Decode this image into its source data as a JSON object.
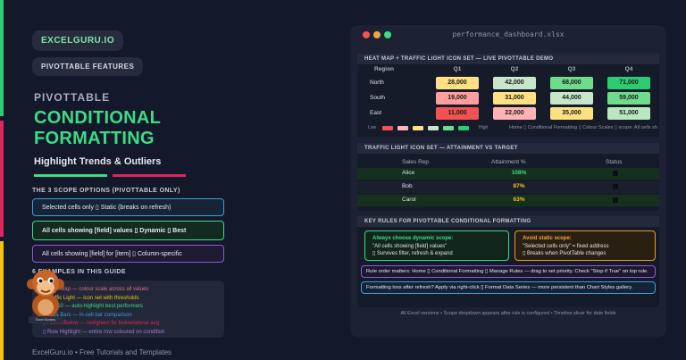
{
  "left": {
    "brand": "EXCELGURU.IO",
    "badge": "PIVOTTABLE FEATURES",
    "kicker": "PIVOTTABLE",
    "headline_1": "CONDITIONAL",
    "headline_2": "FORMATTING",
    "subhead": "Highlight Trends & Outliers",
    "scope_title": "THE 3 SCOPE OPTIONS (PIVOTTABLE ONLY)",
    "scope_options": [
      "Selected cells only ▯ Static (breaks on refresh)",
      "All cells showing [field] values ▯ Dynamic ▯ Best",
      "All cells showing [field] for [item] ▯ Column-specific"
    ],
    "examples_title": "6 EXAMPLES IN THIS GUIDE",
    "examples": [
      "▯ Heat Map — colour scale across all values",
      "▯ Traffic Light — icon set with thresholds",
      "▯ Top 10 — auto-highlight best performers",
      "▯ Data Bars — in-cell bar comparison",
      "▯ Above/Below — red/green for below/above avg",
      "▯ Row Highlight — entire row coloured on condition"
    ],
    "footer": "ExcelGuru.io • Free Tutorials and Templates",
    "mascot_label": "Excel Monkey"
  },
  "window": {
    "title": "performance_dashboard.xlsx",
    "heatmap": {
      "header": "HEAT MAP + TRAFFIC LIGHT ICON SET — LIVE PIVOTTABLE DEMO",
      "row_header": "Region",
      "columns": [
        "Q1",
        "Q2",
        "Q3",
        "Q4"
      ],
      "rows": [
        {
          "label": "North",
          "values": [
            "28,000",
            "42,000",
            "68,000",
            "71,000"
          ],
          "colors": [
            "#ffe082",
            "#c8e6c9",
            "#6fdc8c",
            "#2ecc71"
          ]
        },
        {
          "label": "South",
          "values": [
            "19,000",
            "31,000",
            "44,000",
            "59,000"
          ],
          "colors": [
            "#ff9e9e",
            "#ffe082",
            "#c8e6c9",
            "#6fdc8c"
          ]
        },
        {
          "label": "East",
          "values": [
            "11,000",
            "22,000",
            "35,000",
            "51,000"
          ],
          "colors": [
            "#f25252",
            "#ffb3b3",
            "#ffe082",
            "#b9e8c0"
          ]
        }
      ],
      "legend_low": "Low",
      "legend_high": "High",
      "legend_colors": [
        "#f25252",
        "#ffb3b3",
        "#ffe082",
        "#c8e6c9",
        "#6fdc8c",
        "#2ecc71"
      ],
      "legend_note": "Home ▯ Conditional Formatting ▯ Colour Scales ▯ scope: All cells showing Sales values"
    },
    "traffic": {
      "header": "TRAFFIC LIGHT ICON SET — ATTAINMENT VS TARGET",
      "columns": [
        "Sales Rep",
        "Attainment %",
        "Status"
      ],
      "rows": [
        {
          "name": "Alice",
          "pct": "108%",
          "color": "#3ddc84"
        },
        {
          "name": "Bob",
          "pct": "87%",
          "color": "#f1c40f"
        },
        {
          "name": "Carol",
          "pct": "63%",
          "color": "#f1c40f"
        }
      ]
    },
    "rules": {
      "header": "KEY RULES FOR PIVOTTABLE CONDITIONAL FORMATTING",
      "dynamic_title": "Always choose dynamic scope:",
      "dynamic_line1": "\"All cells showing [field] values\"",
      "dynamic_line2": "▯ Survives filter, refresh & expand",
      "static_title": "Avoid static scope:",
      "static_line1": "\"Selected cells only\" = fixed address",
      "static_line2": "▯ Breaks when PivotTable changes",
      "rule_order": "Rule order matters: Home ▯ Conditional Formatting ▯ Manage Rules — drag to set priority. Check \"Stop if True\" on top rule.",
      "formatting_loss": "Formatting loss after refresh? Apply via right-click ▯ Format Data Series — more persistent than Chart Styles gallery."
    },
    "footer": "All Excel versions • Scope dropdown appears after rule is configured • Timeline slicer for date fields"
  }
}
